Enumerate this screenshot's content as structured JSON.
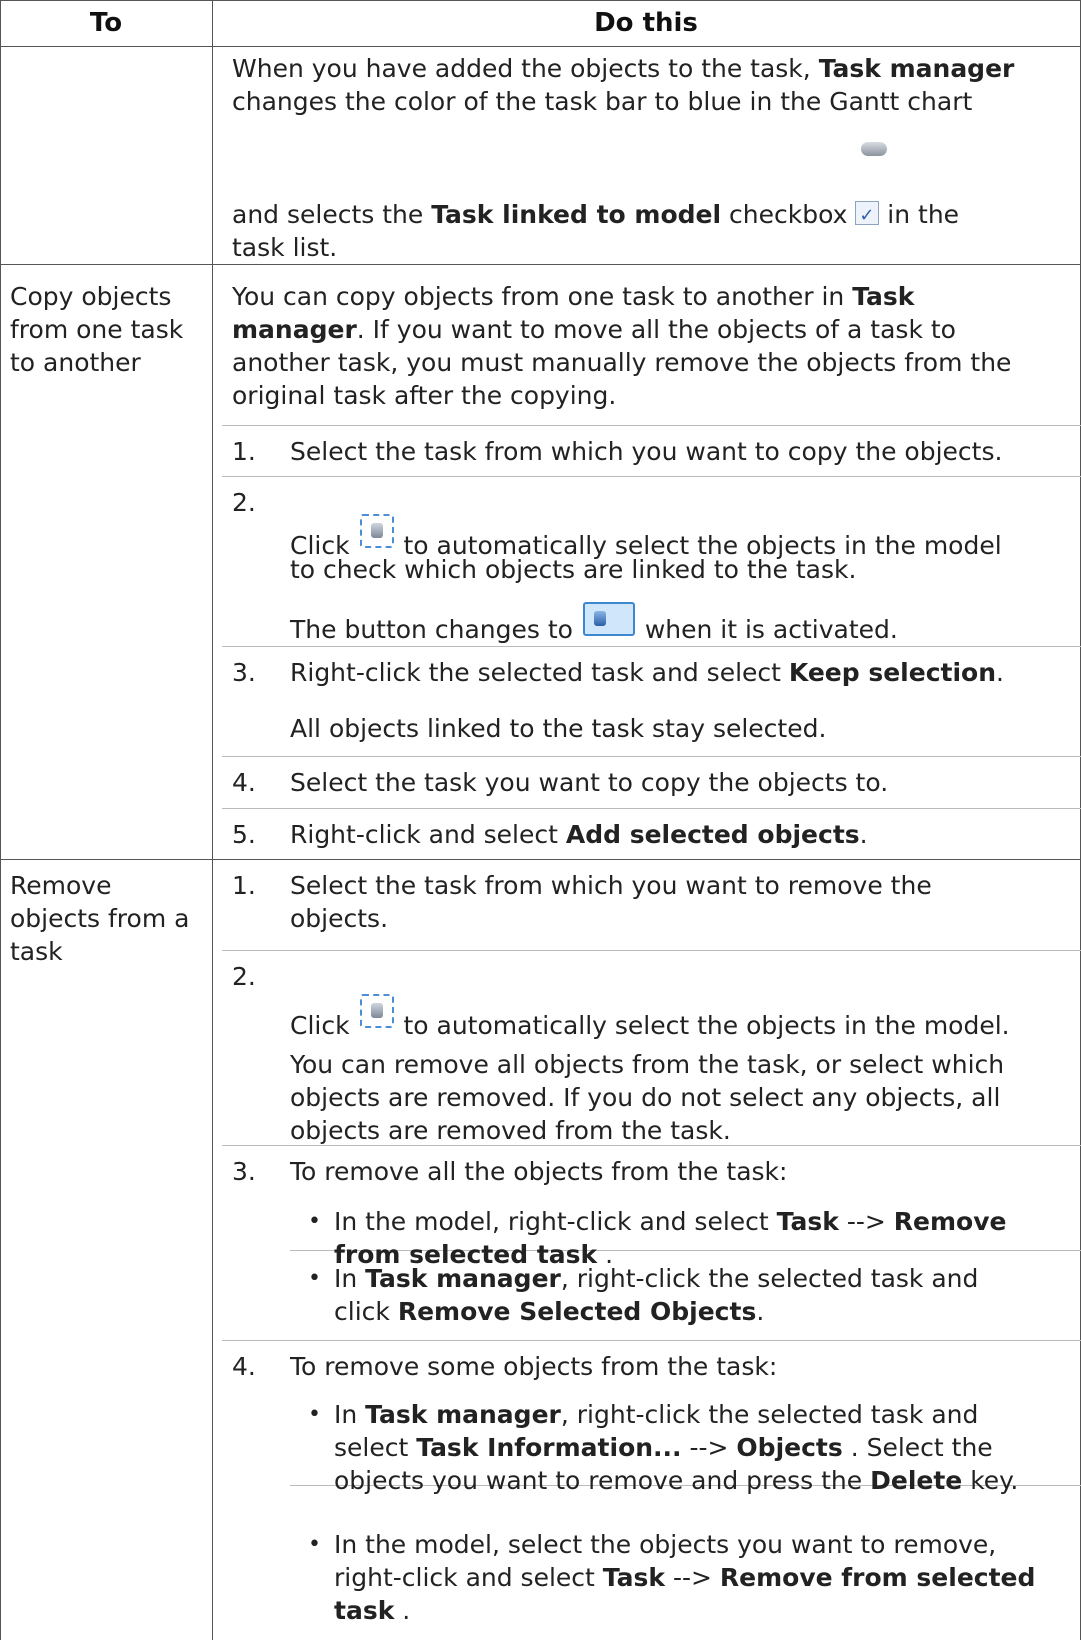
{
  "header": {
    "col_to": "To",
    "col_do": "Do this"
  },
  "row1": {
    "l1": [
      "When you have added the objects to the task, ",
      "Task manager"
    ],
    "l2": "changes the color of the task bar to blue in the Gantt chart",
    "l3": [
      "and selects the ",
      "Task linked to model",
      " checkbox ",
      " in the"
    ],
    "l4": "task list."
  },
  "row2": {
    "to": [
      "Copy objects",
      "from one task",
      "to another"
    ],
    "intro": [
      [
        "You can copy objects from one task to another in ",
        "Task"
      ],
      [
        "manager",
        ". If you want to move all the objects of a task to"
      ],
      "another task, you must manually remove the objects from the",
      "original task after the copying."
    ],
    "steps": [
      {
        "num": "1.",
        "text": "Select the task from which you want to copy the objects."
      },
      {
        "num": "2.",
        "text_a": "Click ",
        "text_b": " to automatically select the objects in the model",
        "text_c": "to check which objects are linked to the task."
      },
      {
        "text_a": "The button changes to ",
        "text_b": " when it is activated."
      },
      {
        "num": "3.",
        "text_a": "Right-click the selected task and select ",
        "bold": "Keep selection",
        "text_b": "."
      },
      {
        "text": "All objects linked to the task stay selected."
      },
      {
        "num": "4.",
        "text": "Select the task you want to copy the objects to."
      },
      {
        "num": "5.",
        "text_a": "Right-click and select ",
        "bold": "Add selected objects",
        "text_b": "."
      }
    ]
  },
  "row3": {
    "to": [
      "Remove",
      "objects from a",
      "task"
    ],
    "s1": {
      "num": "1.",
      "l1": "Select the task from which you want to remove the",
      "l2": "objects."
    },
    "s2": {
      "num": "2.",
      "a": "Click ",
      "b": " to automatically select the objects in the model."
    },
    "note": [
      "You can remove all objects from the task, or select which",
      "objects are removed. If you do not select any objects, all",
      "objects are removed from the task."
    ],
    "s3": {
      "num": "3.",
      "text": "To remove all the objects from the task:"
    },
    "b1": {
      "bullet": "•",
      "a": "In the model, right-click and select ",
      "b1": "Task",
      "arrow": " --> ",
      "b2": "Remove",
      "l2b": "from selected task",
      "l2e": " ."
    },
    "b2": {
      "bullet": "•",
      "a": "In ",
      "b1": "Task manager",
      "c": ", right-click the selected task and",
      "l2a": "click ",
      "l2b": "Remove Selected Objects",
      "l2e": "."
    },
    "s4": {
      "num": "4.",
      "text": "To remove some objects from the task:"
    },
    "b3": {
      "bullet": "•",
      "a": "In ",
      "b1": "Task manager",
      "c": ", right-click the selected task and",
      "l2a": "select ",
      "l2b": "Task Information...",
      "l2c": " --> ",
      "l2d": "Objects",
      "l2e": " . Select the",
      "l3a": "objects you want to remove and press the ",
      "l3b": "Delete",
      "l3c": " key."
    },
    "b4": {
      "bullet": "•",
      "l1": "In the model, select the objects you want to remove,",
      "l2a": "right-click and select ",
      "l2b": "Task",
      "l2c": " --> ",
      "l2d": "Remove from selected",
      "l3b": "task",
      "l3c": " ."
    }
  },
  "icons": [
    "link-icon",
    "checkbox-icon",
    "select-objects-icon",
    "select-objects-active-icon"
  ]
}
